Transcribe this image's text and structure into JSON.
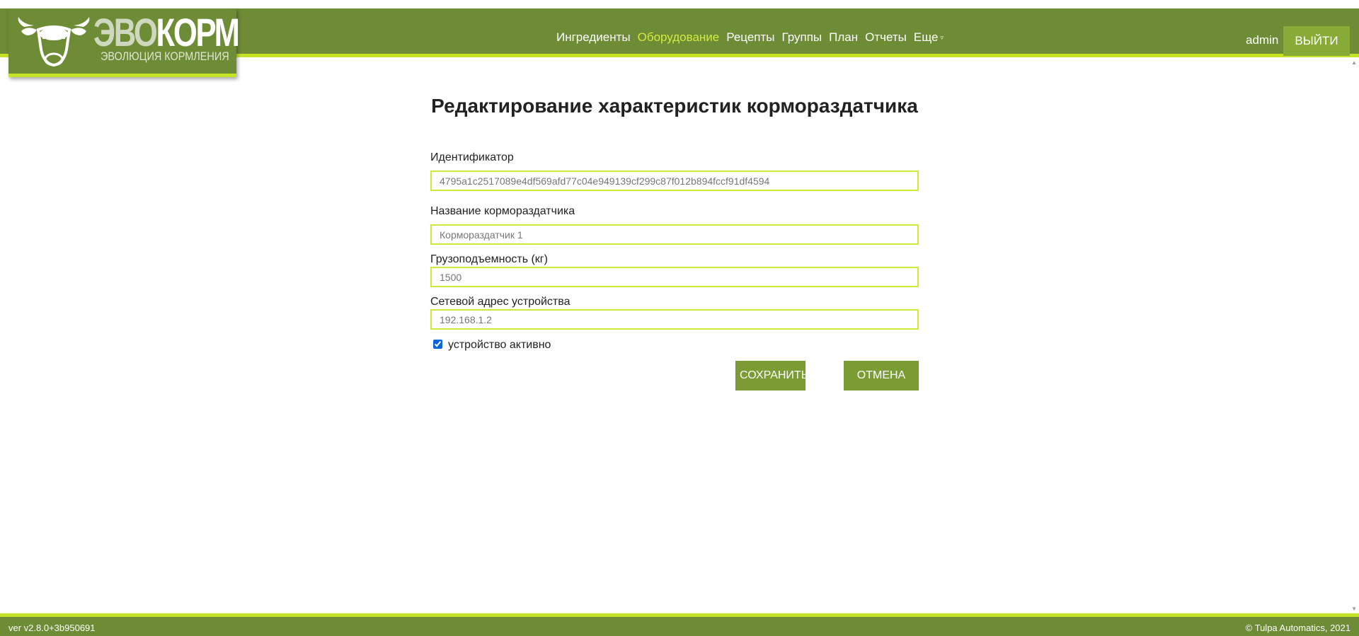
{
  "header": {
    "brand_part1": "ЭВО",
    "brand_part2": "КОРМ",
    "slogan": "ЭВОЛЮЦИЯ КОРМЛЕНИЯ",
    "nav": [
      {
        "label": "Ингредиенты",
        "active": false
      },
      {
        "label": "Оборудование",
        "active": true
      },
      {
        "label": "Рецепты",
        "active": false
      },
      {
        "label": "Группы",
        "active": false
      },
      {
        "label": "План",
        "active": false
      },
      {
        "label": "Отчеты",
        "active": false
      },
      {
        "label": "Еще",
        "active": false
      }
    ],
    "more_caret": "▿",
    "user": "admin",
    "logout_label": "ВЫЙТИ"
  },
  "page": {
    "title": "Редактирование характеристик кормораздатчика"
  },
  "form": {
    "id_label": "Идентификатор",
    "id_value": "4795a1c2517089e4df569afd77c04e949139cf299c87f012b894fccf91df4594",
    "name_label": "Название кормораздатчика",
    "name_value": "Кормораздатчик 1",
    "capacity_label": "Грузоподъемность (кг)",
    "capacity_value": "1500",
    "address_label": "Сетевой адрес устройства",
    "address_value": "192.168.1.2",
    "active_label": "устройство активно",
    "active_checked": true,
    "save_label": "СОХРАНИТЬ",
    "cancel_label": "ОТМЕНА"
  },
  "footer": {
    "version": "ver v2.8.0+3b950691",
    "copyright": "© Tulpa Automatics, 2021"
  },
  "colors": {
    "header_bg": "#6e8b35",
    "accent_line": "#c5e324",
    "active_nav": "#d3ea3f",
    "button_bg": "#7a9c32"
  }
}
